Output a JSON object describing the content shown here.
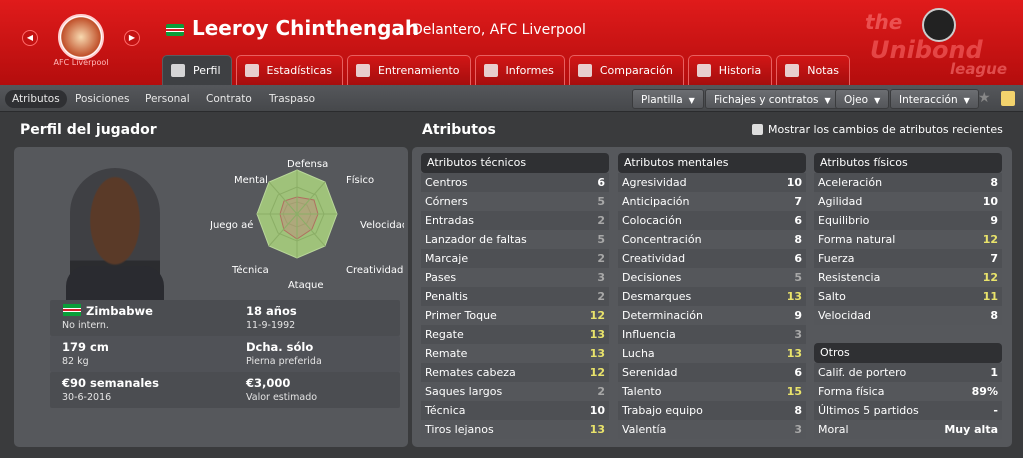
{
  "header": {
    "player_name": "Leeroy Chinthengah",
    "player_subtitle": "Delantero, AFC Liverpool",
    "club_name_small": "AFC Liverpool",
    "brand_line1": "the",
    "brand_line2": "Unibond",
    "brand_line3": "league"
  },
  "main_tabs": [
    {
      "label": "Perfil",
      "active": true
    },
    {
      "label": "Estadísticas"
    },
    {
      "label": "Entrenamiento"
    },
    {
      "label": "Informes"
    },
    {
      "label": "Comparación"
    },
    {
      "label": "Historia"
    },
    {
      "label": "Notas"
    }
  ],
  "sub_tabs": [
    "Atributos",
    "Posiciones",
    "Personal",
    "Contrato",
    "Traspaso"
  ],
  "dropdowns": [
    "Plantilla",
    "Fichajes y contratos",
    "Ojeo",
    "Interacción"
  ],
  "profile": {
    "title": "Perfil del jugador",
    "radar_labels": {
      "top": "Defensa",
      "top_left": "Mental",
      "top_right": "Físico",
      "left": "Juego aéreo",
      "right": "Velocidad",
      "bottom_left": "Técnica",
      "bottom_right": "Creatividad",
      "bottom": "Ataque"
    },
    "rows": [
      {
        "l_big": "Zimbabwe",
        "l_small": "No intern.",
        "r_big": "18 años",
        "r_small": "11-9-1992"
      },
      {
        "l_big": "179 cm",
        "l_small": "82 kg",
        "r_big": "Dcha. sólo",
        "r_small": "Pierna preferida"
      },
      {
        "l_big": "€90 semanales",
        "l_small": "30-6-2016",
        "r_big": "€3,000",
        "r_small": "Valor estimado"
      }
    ]
  },
  "attributes": {
    "title": "Atributos",
    "checkbox_label": "Mostrar los cambios de atributos recientes",
    "technical": {
      "header": "Atributos técnicos",
      "items": [
        [
          "Centros",
          6
        ],
        [
          "Córners",
          5
        ],
        [
          "Entradas",
          2
        ],
        [
          "Lanzador de faltas",
          5
        ],
        [
          "Marcaje",
          2
        ],
        [
          "Pases",
          3
        ],
        [
          "Penaltis",
          2
        ],
        [
          "Primer Toque",
          12
        ],
        [
          "Regate",
          13
        ],
        [
          "Remate",
          13
        ],
        [
          "Remates cabeza",
          12
        ],
        [
          "Saques largos",
          2
        ],
        [
          "Técnica",
          10
        ],
        [
          "Tiros lejanos",
          13
        ]
      ]
    },
    "mental": {
      "header": "Atributos mentales",
      "items": [
        [
          "Agresividad",
          10
        ],
        [
          "Anticipación",
          7
        ],
        [
          "Colocación",
          6
        ],
        [
          "Concentración",
          8
        ],
        [
          "Creatividad",
          6
        ],
        [
          "Decisiones",
          5
        ],
        [
          "Desmarques",
          13
        ],
        [
          "Determinación",
          9
        ],
        [
          "Influencia",
          3
        ],
        [
          "Lucha",
          13
        ],
        [
          "Serenidad",
          6
        ],
        [
          "Talento",
          15
        ],
        [
          "Trabajo equipo",
          8
        ],
        [
          "Valentía",
          3
        ]
      ]
    },
    "physical": {
      "header": "Atributos físicos",
      "items": [
        [
          "Aceleración",
          8
        ],
        [
          "Agilidad",
          10
        ],
        [
          "Equilibrio",
          9
        ],
        [
          "Forma natural",
          12
        ],
        [
          "Fuerza",
          7
        ],
        [
          "Resistencia",
          12
        ],
        [
          "Salto",
          11
        ],
        [
          "Velocidad",
          8
        ]
      ]
    },
    "others": {
      "header": "Otros",
      "items": [
        [
          "Calif. de portero",
          "1"
        ],
        [
          "Forma física",
          "89%"
        ],
        [
          "Últimos 5 partidos",
          "-"
        ],
        [
          "Moral",
          "Muy alta"
        ]
      ]
    }
  }
}
